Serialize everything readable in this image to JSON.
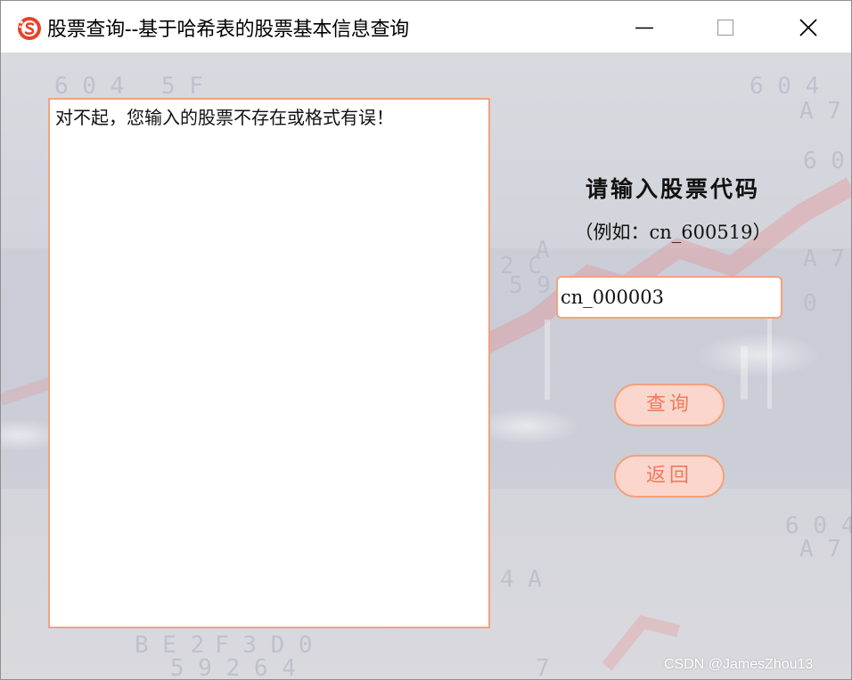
{
  "window": {
    "title": "股票查询--基于哈希表的股票基本信息查询",
    "app_icon": "red-s-logo-icon",
    "controls": {
      "minimize": "minimize-icon",
      "maximize": "maximize-icon",
      "close": "close-icon"
    }
  },
  "output": {
    "message": "对不起，您输入的股票不存在或格式有误！"
  },
  "query_panel": {
    "title": "请输入股票代码",
    "example": "（例如：cn_600519）",
    "input_value": "cn_000003",
    "query_button": "查询",
    "back_button": "返回"
  },
  "watermark": "CSDN @JamesZhou13",
  "colors": {
    "accent_border": "#f4a17e",
    "button_fill": "#fbd6cc",
    "button_text": "#f07a5c",
    "background": "#d7d8dd"
  }
}
